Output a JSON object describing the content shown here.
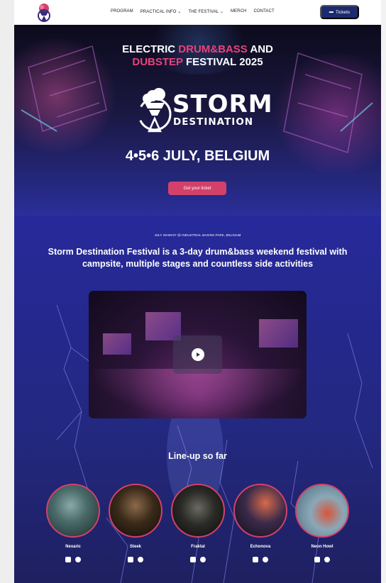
{
  "nav": {
    "links": [
      "PROGRAM",
      "PRACTICAL INFO",
      "THE FESTIVAL",
      "MERCH",
      "CONTACT"
    ],
    "tickets_label": "Tickets"
  },
  "hero": {
    "title_part1": "ELECTRIC ",
    "title_pink1": "DRUM&BASS",
    "title_part2": " AND",
    "title_pink2": "DUBSTEP",
    "title_part3": " FESTIVAL 2025",
    "logo_word1": "STORM",
    "logo_word2": "DESTINATION",
    "dates": "4•5•6 JULY, BELGIUM",
    "cta": "Get your ticket"
  },
  "intro": {
    "small_line": "JULY 25•26•27 @ INDUSTRIAL BASINS PARK, BELGIUM",
    "headline": "Storm Destination Festival is a 3-day drum&bass weekend festival with campsite, multiple stages and countless side activities"
  },
  "lineup": {
    "title": "Line-up so far",
    "artists": [
      {
        "name": "Nexaric"
      },
      {
        "name": "Steek"
      },
      {
        "name": "Fraktal"
      },
      {
        "name": "Echonova"
      },
      {
        "name": "Neon Howl"
      }
    ]
  },
  "colors": {
    "accent": "#d3416b",
    "nav_button": "#1c2a6e",
    "background": "#25288a"
  },
  "icons": [
    "festival-logo-icon",
    "chevron-down-icon",
    "ticket-icon",
    "play-icon",
    "apple-music-icon",
    "spotify-icon"
  ]
}
